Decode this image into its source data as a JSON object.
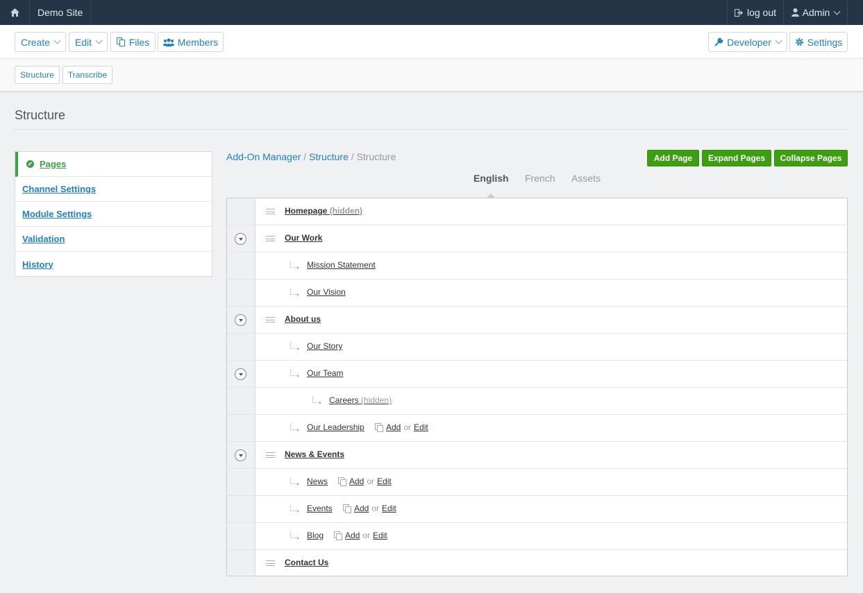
{
  "topbar": {
    "site_name": "Demo Site",
    "logout_label": "log out",
    "admin_label": "Admin"
  },
  "mainnav": {
    "create": "Create",
    "edit": "Edit",
    "files": "Files",
    "members": "Members",
    "developer": "Developer",
    "settings": "Settings"
  },
  "subnav": {
    "structure": "Structure",
    "transcribe": "Transcribe"
  },
  "page": {
    "title": "Structure"
  },
  "sidebar": {
    "items": [
      {
        "label": "Pages",
        "active": true
      },
      {
        "label": "Channel Settings"
      },
      {
        "label": "Module Settings"
      },
      {
        "label": "Validation"
      },
      {
        "label": "History"
      }
    ]
  },
  "breadcrumb": {
    "items": [
      "Add-On Manager",
      "Structure"
    ],
    "current": "Structure",
    "separator": "/"
  },
  "actions": {
    "add_page": "Add Page",
    "expand_pages": "Expand Pages",
    "collapse_pages": "Collapse Pages"
  },
  "languages": {
    "tabs": [
      "English",
      "French",
      "Assets"
    ],
    "active": "English"
  },
  "tree": {
    "add_label": "Add",
    "or_label": "or",
    "edit_label": "Edit",
    "rows": [
      {
        "name": "Homepage",
        "depth": 0,
        "tag": "(hidden)"
      },
      {
        "name": "Our Work",
        "depth": 0,
        "toggle": true
      },
      {
        "name": "Mission Statement",
        "depth": 1
      },
      {
        "name": "Our Vision",
        "depth": 1
      },
      {
        "name": "About us",
        "depth": 0,
        "toggle": true
      },
      {
        "name": "Our Story",
        "depth": 1
      },
      {
        "name": "Our Team",
        "depth": 1,
        "toggle": true
      },
      {
        "name": "Careers",
        "depth": 2,
        "tag": "(hidden)"
      },
      {
        "name": "Our Leadership",
        "depth": 1,
        "listing": true
      },
      {
        "name": "News & Events",
        "depth": 0,
        "toggle": true
      },
      {
        "name": "News",
        "depth": 1,
        "listing": true
      },
      {
        "name": "Events",
        "depth": 1,
        "listing": true
      },
      {
        "name": "Blog",
        "depth": 1,
        "listing": true
      },
      {
        "name": "Contact Us",
        "depth": 0
      }
    ]
  },
  "colors": {
    "topbar_bg": "#253547",
    "link_blue": "#1f80c6",
    "green_button": "#3e9e11",
    "active_green": "#3aa345"
  }
}
